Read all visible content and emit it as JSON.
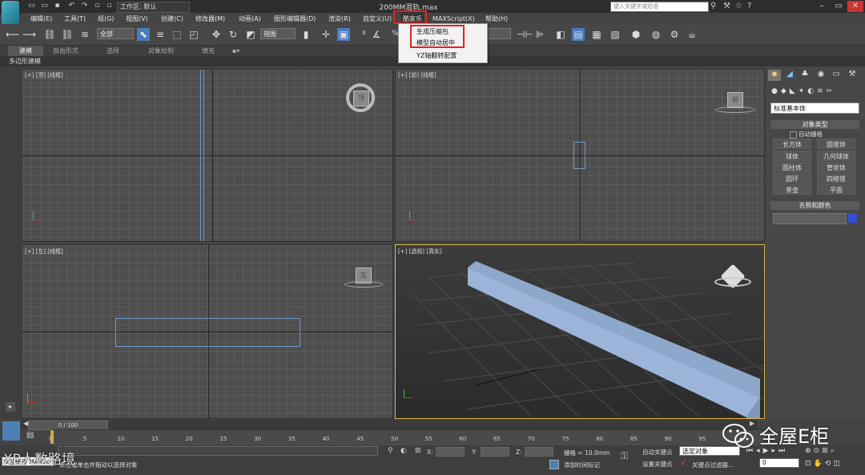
{
  "title_bar": {
    "workspace_label": "工作区: 默认",
    "document_title": "200MM混轨.max",
    "search_placeholder": "键入关键字或短语"
  },
  "menu": {
    "items": [
      "编辑(E)",
      "工具(T)",
      "组(G)",
      "视图(V)",
      "创建(C)",
      "修改器(M)",
      "动画(A)",
      "图形编辑器(D)",
      "渲染(R)",
      "自定义(U)",
      "酷家乐",
      "MAXScript(X)",
      "帮助(H)"
    ]
  },
  "dropdown": {
    "items": [
      "生成压缩包",
      "模型自动居中",
      "YZ轴翻转配置"
    ]
  },
  "toolbar": {
    "selection_filter": "全部",
    "reference_coord": "视图",
    "percent_label": "%"
  },
  "ribbon": {
    "tabs": [
      "建模",
      "自由形式",
      "选择",
      "对象绘制",
      "填充"
    ],
    "sub_label": "多边形建模"
  },
  "viewports": {
    "top": "[+] [顶] [线框]",
    "front": "[+] [前] [线框]",
    "left": "[+] [左] [线框]",
    "perspective": "[+] [透视] [真实]",
    "cube_top": "顶",
    "cube_front": "前",
    "cube_left": "左"
  },
  "command_panel": {
    "dropdown": "标准基本体",
    "object_type_header": "对象类型",
    "autogrid": "自动栅格",
    "buttons": [
      "长方体",
      "圆锥体",
      "球体",
      "几何球体",
      "圆柱体",
      "管状体",
      "圆环",
      "四棱锥",
      "茶壶",
      "平面"
    ],
    "name_color_header": "名称和颜色"
  },
  "timeline": {
    "frame": "0 / 100",
    "ticks": [
      "0",
      "5",
      "10",
      "15",
      "20",
      "25",
      "30",
      "35",
      "40",
      "45",
      "50",
      "55",
      "60",
      "65",
      "70",
      "75",
      "80",
      "85",
      "90",
      "95"
    ]
  },
  "status": {
    "script_label": "欢迎使用 MAXSc",
    "prompt": "单击或单击并拖动以选择对象",
    "x_label": "X:",
    "y_label": "Y:",
    "z_label": "Z:",
    "grid": "栅格 = 10.0mm",
    "autokey": "自动关键点",
    "selected": "选定对象",
    "setkey": "设置关键点",
    "keyfilter": "关键点过滤器...",
    "add_time_tag": "添加时间标记",
    "frame_value": "0"
  },
  "watermark": {
    "brand": "全屋E柜",
    "secondary": "XP人数路境"
  },
  "colors": {
    "accent_red": "#e52222",
    "beam_blue": "#9cb4d8",
    "selection_blue": "#6f9bd1"
  }
}
